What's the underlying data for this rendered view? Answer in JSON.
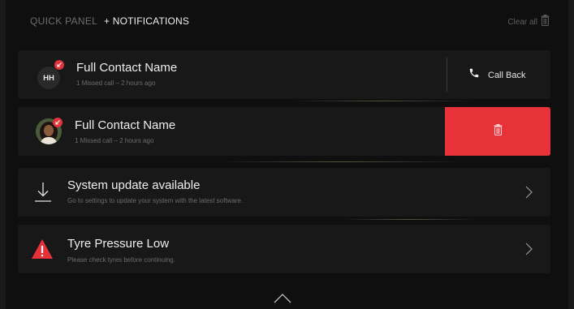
{
  "header": {
    "tab_quick_panel": "QUICK PANEL",
    "tab_notifications": "+ NOTIFICATIONS",
    "clear_all": "Clear all"
  },
  "notifications": [
    {
      "type": "missed_call",
      "avatar_initials": "HH",
      "title": "Full Contact Name",
      "subtitle": "1 Missed call – 2 hours ago",
      "action_label": "Call Back",
      "action_icon": "phone-icon"
    },
    {
      "type": "missed_call_swiped",
      "avatar_icon": "contact-photo",
      "title": "Full Contact Name",
      "subtitle": "1 Missed call – 2 hours ago",
      "action_icon": "trash-icon"
    },
    {
      "type": "system",
      "icon": "download-icon",
      "title": "System update available",
      "subtitle": "Go to settings to update your system with the latest software."
    },
    {
      "type": "warning",
      "icon": "warning-icon",
      "title": "Tyre Pressure Low",
      "subtitle": "Please check tyres before continuing."
    }
  ],
  "colors": {
    "background": "#0f0f10",
    "card": "#181818",
    "accent_red": "#e8323a",
    "text_primary": "#eeeeee",
    "text_secondary": "#6c6c6c"
  }
}
